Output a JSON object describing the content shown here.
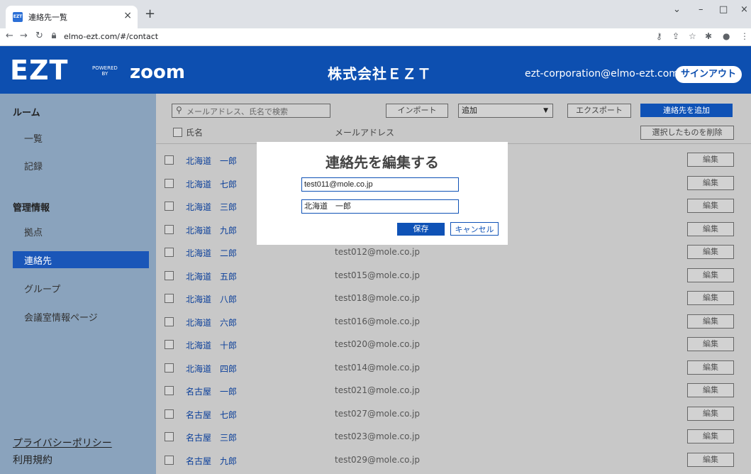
{
  "browser": {
    "tab_title": "連絡先一覧",
    "favicon_text": "EZT",
    "url": "elmo-ezt.com/#/contact"
  },
  "header": {
    "logo": "EZT",
    "powered": "POWERED",
    "by": "BY",
    "zoom": "zoom",
    "company": "株式会社ＥＺＴ",
    "email": "ezt-corporation@elmo-ezt.com",
    "signout": "サインアウト"
  },
  "sidebar": {
    "room_heading": "ルーム",
    "room_items": [
      "一覧",
      "記録"
    ],
    "admin_heading": "管理情報",
    "admin_items": [
      "拠点",
      "連絡先",
      "グループ",
      "会議室情報ページ"
    ],
    "privacy": "プライバシーポリシー",
    "terms": "利用規約"
  },
  "toolbar": {
    "search_placeholder": "メールアドレス、氏名で検索",
    "import": "インポート",
    "select_value": "追加",
    "export": "エクスポート",
    "add_contact": "連絡先を追加",
    "delete_selected": "選択したものを削除"
  },
  "table": {
    "col_name": "氏名",
    "col_email": "メールアドレス",
    "edit_label": "編集",
    "rows": [
      {
        "name": "北海道　一郎",
        "email": ""
      },
      {
        "name": "北海道　七郎",
        "email": ""
      },
      {
        "name": "北海道　三郎",
        "email": ""
      },
      {
        "name": "北海道　九郎",
        "email": ""
      },
      {
        "name": "北海道　二郎",
        "email": "test012@mole.co.jp"
      },
      {
        "name": "北海道　五郎",
        "email": "test015@mole.co.jp"
      },
      {
        "name": "北海道　八郎",
        "email": "test018@mole.co.jp"
      },
      {
        "name": "北海道　六郎",
        "email": "test016@mole.co.jp"
      },
      {
        "name": "北海道　十郎",
        "email": "test020@mole.co.jp"
      },
      {
        "name": "北海道　四郎",
        "email": "test014@mole.co.jp"
      },
      {
        "name": "名古屋　一郎",
        "email": "test021@mole.co.jp"
      },
      {
        "name": "名古屋　七郎",
        "email": "test027@mole.co.jp"
      },
      {
        "name": "名古屋　三郎",
        "email": "test023@mole.co.jp"
      },
      {
        "name": "名古屋　九郎",
        "email": "test029@mole.co.jp"
      }
    ]
  },
  "modal": {
    "title": "連絡先を編集する",
    "email_value": "test011@mole.co.jp",
    "name_value": "北海道　一郎",
    "save": "保存",
    "cancel": "キャンセル"
  }
}
